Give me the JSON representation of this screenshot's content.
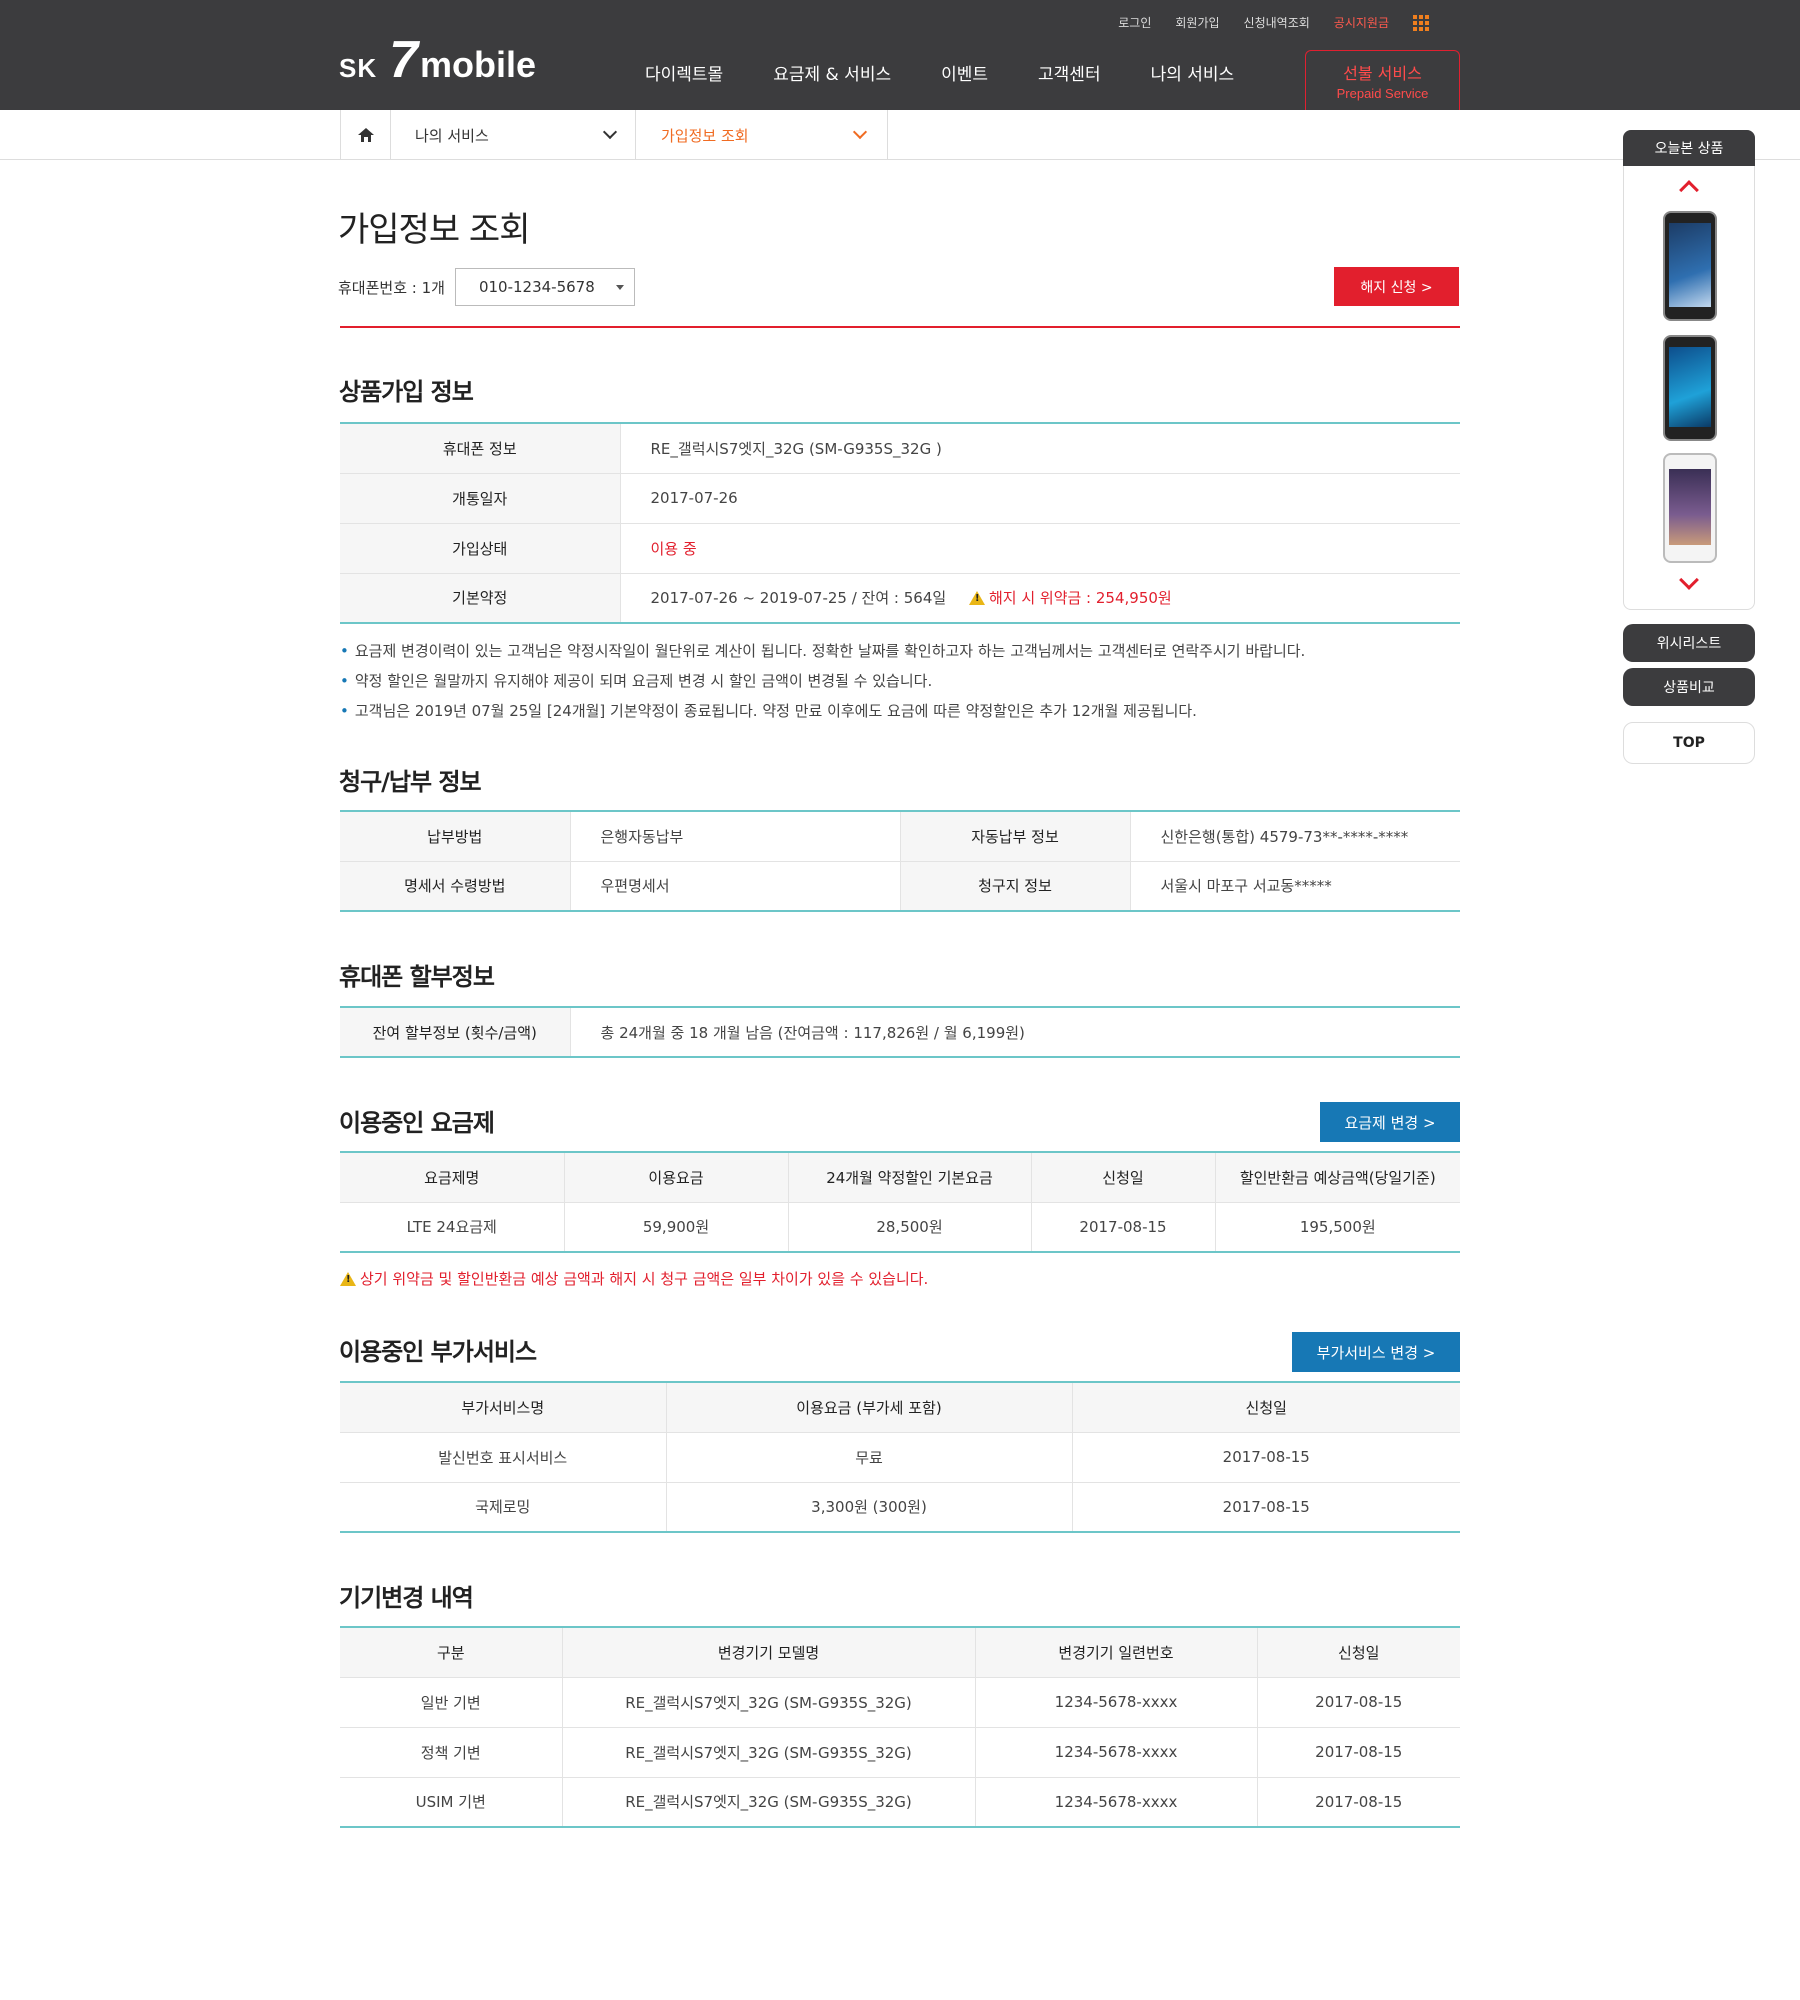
{
  "header": {
    "util_links": [
      "로그인",
      "회원가입",
      "신청내역조회",
      "공시지원금"
    ],
    "logo": {
      "sk": "SK",
      "seven": "7",
      "mobile": "mobile"
    },
    "gnb": [
      "다이렉트몰",
      "요금제 & 서비스",
      "이벤트",
      "고객센터",
      "나의 서비스"
    ],
    "prepaid": {
      "title": "선불 서비스",
      "subtitle": "Prepaid Service"
    }
  },
  "breadcrumb": {
    "level1": "나의 서비스",
    "level2": "가입정보 조회"
  },
  "page": {
    "title": "가입정보 조회",
    "phone_label": "휴대폰번호 : 1개",
    "phone_selected": "010-1234-5678",
    "cancel_button": "해지 신청 >"
  },
  "product_info": {
    "title": "상품가입 정보",
    "rows": [
      {
        "label": "휴대폰 정보",
        "value": "RE_갤럭시S7엣지_32G (SM-G935S_32G )"
      },
      {
        "label": "개통일자",
        "value": "2017-07-26"
      },
      {
        "label": "가입상태",
        "value": "이용 중"
      },
      {
        "label": "기본약정",
        "value": "2017-07-26 ~ 2019-07-25 / 잔여 : 564일",
        "warning": "해지 시 위약금 : 254,950원"
      }
    ],
    "notes": [
      "요금제 변경이력이 있는 고객님은 약정시작일이 월단위로 계산이 됩니다. 정확한 날짜를 확인하고자 하는 고객님께서는 고객센터로 연락주시기 바랍니다.",
      "약정 할인은 월말까지 유지해야 제공이 되며 요금제 변경 시 할인 금액이 변경될 수 있습니다.",
      "고객님은 2019년 07월 25일 [24개월] 기본약정이 종료됩니다. 약정 만료 이후에도 요금에 따른 약정할인은 추가 12개월 제공됩니다."
    ]
  },
  "billing": {
    "title": "청구/납부 정보",
    "rows": [
      {
        "l1": "납부방법",
        "v1": "은행자동납부",
        "l2": "자동납부 정보",
        "v2": "신한은행(통합) 4579-73**-****-****"
      },
      {
        "l1": "명세서 수령방법",
        "v1": "우편명세서",
        "l2": "청구지 정보",
        "v2": "서울시 마포구 서교동*****"
      }
    ]
  },
  "installment": {
    "title": "휴대폰 할부정보",
    "label": "잔여 할부정보 (횟수/금액)",
    "value": "총 24개월 중 18 개월 남음 (잔여금액 : 117,826원 / 월 6,199원)"
  },
  "plan": {
    "title": "이용중인 요금제",
    "button": "요금제 변경 >",
    "headers": [
      "요금제명",
      "이용요금",
      "24개월 약정할인 기본요금",
      "신청일",
      "할인반환금 예상금액(당일기준)"
    ],
    "row": [
      "LTE 24요금제",
      "59,900원",
      "28,500원",
      "2017-08-15",
      "195,500원"
    ],
    "warning": "상기 위약금 및 할인반환금 예상 금액과 해지 시 청구 금액은 일부 차이가 있을 수 있습니다."
  },
  "addon": {
    "title": "이용중인 부가서비스",
    "button": "부가서비스 변경 >",
    "headers": [
      "부가서비스명",
      "이용요금 (부가세 포함)",
      "신청일"
    ],
    "rows": [
      [
        "발신번호 표시서비스",
        "무료",
        "2017-08-15"
      ],
      [
        "국제로밍",
        "3,300원 (300원)",
        "2017-08-15"
      ]
    ]
  },
  "device_change": {
    "title": "기기변경 내역",
    "headers": [
      "구분",
      "변경기기 모델명",
      "변경기기 일련번호",
      "신청일"
    ],
    "rows": [
      [
        "일반 기변",
        "RE_갤럭시S7엣지_32G (SM-G935S_32G)",
        "1234-5678-xxxx",
        "2017-08-15"
      ],
      [
        "정책 기변",
        "RE_갤럭시S7엣지_32G (SM-G935S_32G)",
        "1234-5678-xxxx",
        "2017-08-15"
      ],
      [
        "USIM 기변",
        "RE_갤럭시S7엣지_32G (SM-G935S_32G)",
        "1234-5678-xxxx",
        "2017-08-15"
      ]
    ]
  },
  "rail": {
    "recent_title": "오늘본 상품",
    "wishlist": "위시리스트",
    "compare": "상품비교",
    "top": "TOP"
  }
}
